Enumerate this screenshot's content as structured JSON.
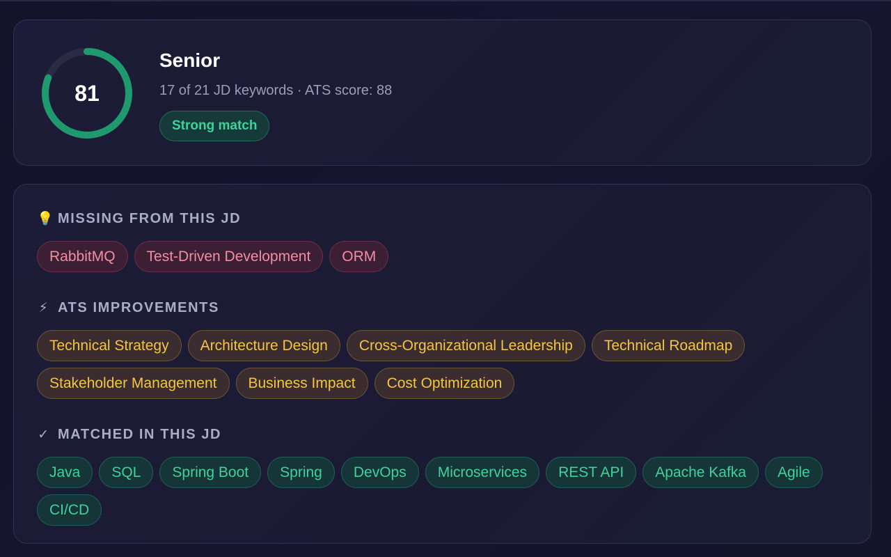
{
  "score": {
    "value": "81",
    "fraction": 0.81,
    "ring_color": "#1e9a6e",
    "track_color": "#2c2b45",
    "level": "Senior",
    "meta": "17 of 21 JD keywords · ATS score: 88",
    "badge": "Strong match"
  },
  "sections": {
    "missing": {
      "icon": "💡",
      "title": "MISSING FROM THIS JD",
      "tags": [
        "RabbitMQ",
        "Test-Driven Development",
        "ORM"
      ]
    },
    "improvements": {
      "icon": "⚡",
      "title": "ATS IMPROVEMENTS",
      "tags": [
        "Technical Strategy",
        "Architecture Design",
        "Cross-Organizational Leadership",
        "Technical Roadmap",
        "Stakeholder Management",
        "Business Impact",
        "Cost Optimization"
      ]
    },
    "matched": {
      "icon": "✓",
      "title": "MATCHED IN THIS JD",
      "tags": [
        "Java",
        "SQL",
        "Spring Boot",
        "Spring",
        "DevOps",
        "Microservices",
        "REST API",
        "Apache Kafka",
        "Agile",
        "CI/CD"
      ]
    }
  }
}
